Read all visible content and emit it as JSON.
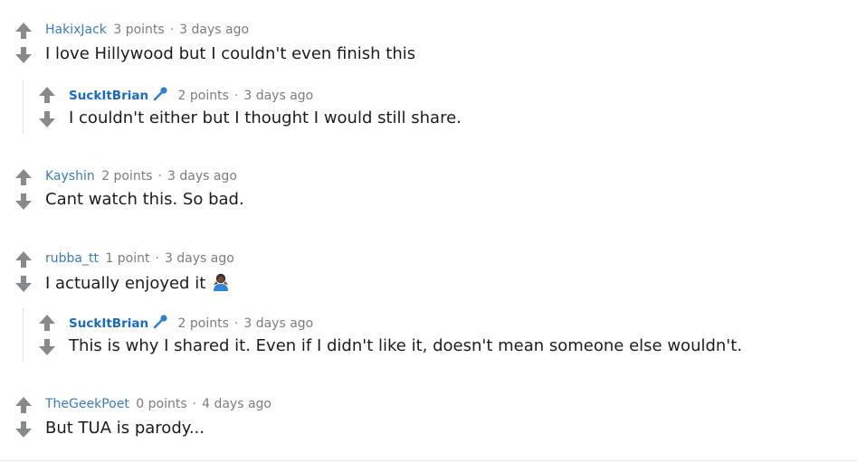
{
  "comments": [
    {
      "author": "HakixJack",
      "points": "3 points",
      "time": "3 days ago",
      "text": "I love Hillywood but I couldn't even finish this"
    },
    {
      "author": "SuckItBrian",
      "points": "2 points",
      "time": "3 days ago",
      "text": "I couldn't either but I thought I would still share."
    },
    {
      "author": "Kayshin",
      "points": "2 points",
      "time": "3 days ago",
      "text": "Cant watch this. So bad."
    },
    {
      "author": "rubba_tt",
      "points": "1 point",
      "time": "3 days ago",
      "text": "I actually enjoyed it"
    },
    {
      "author": "SuckItBrian",
      "points": "2 points",
      "time": "3 days ago",
      "text": "This is why I shared it. Even if I didn't like it, doesn't mean someone else wouldn't."
    },
    {
      "author": "TheGeekPoet",
      "points": "0 points",
      "time": "4 days ago",
      "text": "But TUA is parody..."
    }
  ],
  "separator": "·",
  "icons": {
    "upvote": "upvote-arrow-icon",
    "downvote": "downvote-arrow-icon",
    "op_badge": "microphone-icon",
    "emoji": "person-gesturing-emoji"
  },
  "colors": {
    "author": "#3b7bbf",
    "op_author": "#1a6bbf",
    "meta": "#7c7c7c",
    "arrow": "#878a8c",
    "thread_line": "#e4e4e4",
    "text": "#1c1c1c"
  }
}
